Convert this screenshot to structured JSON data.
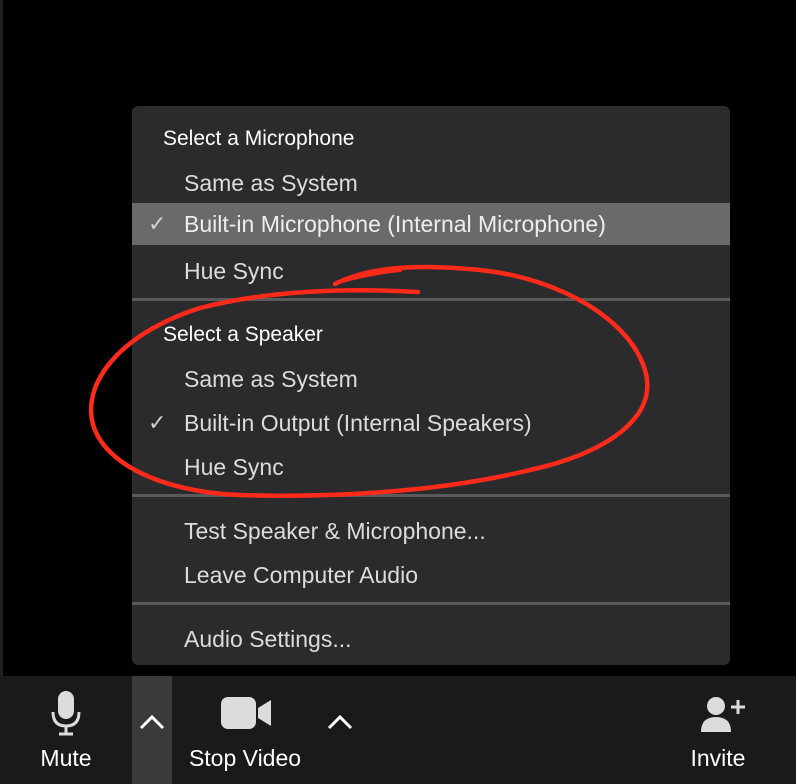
{
  "menu": {
    "microphone": {
      "header": "Select a Microphone",
      "items": [
        {
          "label": "Same as System",
          "checked": false
        },
        {
          "label": "Built-in Microphone (Internal Microphone)",
          "checked": true
        },
        {
          "label": "Hue Sync",
          "checked": false
        }
      ]
    },
    "speaker": {
      "header": "Select a Speaker",
      "items": [
        {
          "label": "Same as System",
          "checked": false
        },
        {
          "label": "Built-in Output (Internal Speakers)",
          "checked": true
        },
        {
          "label": "Hue Sync",
          "checked": false
        }
      ]
    },
    "actions": {
      "test": "Test Speaker & Microphone...",
      "leave": "Leave Computer Audio",
      "settings": "Audio Settings..."
    },
    "check_glyph": "✓"
  },
  "toolbar": {
    "mute_label": "Mute",
    "stop_video_label": "Stop Video",
    "invite_label": "Invite",
    "caret_glyph": "^"
  },
  "icons": {
    "mute": "microphone-icon",
    "video": "video-camera-icon",
    "invite": "add-person-icon",
    "caret": "chevron-up-icon",
    "check": "checkmark-icon"
  },
  "colors": {
    "background": "#000000",
    "menu_bg": "#2b2b2d",
    "highlight": "#6a6a6c",
    "separator": "#5a5a5c",
    "toolbar_bg": "#1a1a1a",
    "annotation": "#ff2a1a"
  }
}
